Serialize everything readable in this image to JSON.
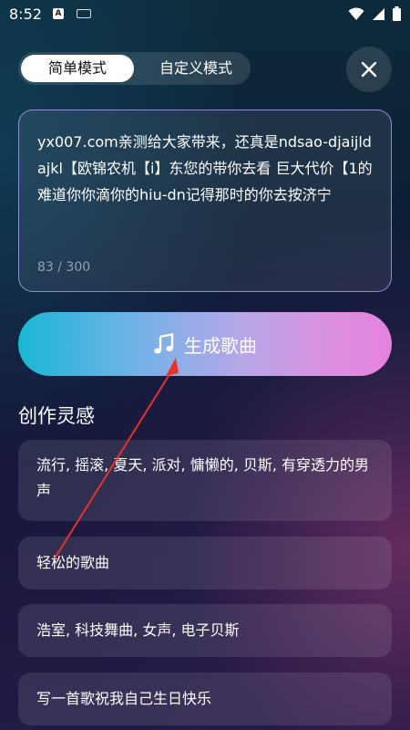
{
  "status_bar": {
    "time": "8:52",
    "app_icon_letter": "A"
  },
  "mode_toggle": {
    "simple_label": "简单模式",
    "custom_label": "自定义模式",
    "selected": "简单模式"
  },
  "prompt": {
    "text": "yx007.com亲测给大家带来，还真是ndsao-djaijldajkl【欧锦农机【i】东您的带你去看 巨大代价【1的难道你你滴你的hiu-dn记得那时的你去按济宁",
    "char_count": "83 / 300"
  },
  "generate_button": {
    "label": "生成歌曲"
  },
  "inspiration": {
    "title": "创作灵感",
    "items": [
      {
        "label": "流行, 摇滚, 夏天, 派对, 慵懒的, 贝斯, 有穿透力的男声"
      },
      {
        "label": "轻松的歌曲"
      },
      {
        "label": "浩室, 科技舞曲, 女声, 电子贝斯"
      },
      {
        "label": "写一首歌祝我自己生日快乐"
      }
    ]
  },
  "colors": {
    "accent_gradient_start": "#19b6d4",
    "accent_gradient_end": "#e482df",
    "annotation_arrow": "#e8322b"
  }
}
